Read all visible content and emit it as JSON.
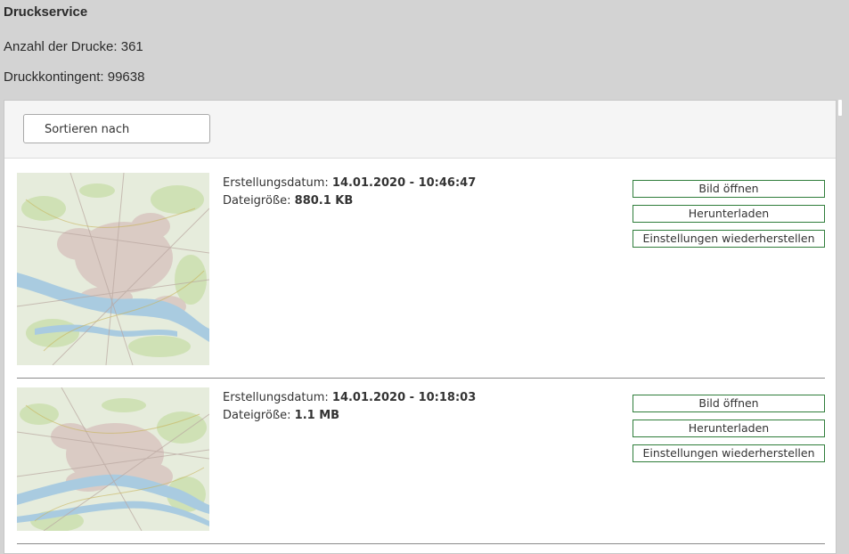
{
  "header": {
    "title": "Druckservice",
    "print_count_label": "Anzahl der Drucke: 361",
    "quota_label": "Druckkontingent: 99638"
  },
  "toolbar": {
    "sort_label": "Sortieren nach"
  },
  "prints": [
    {
      "created_label": "Erstellungsdatum:",
      "created_value": "14.01.2020 - 10:46:47",
      "size_label": "Dateigröße:",
      "size_value": "880.1 KB",
      "open_label": "Bild öffnen",
      "download_label": "Herunterladen",
      "restore_label": "Einstellungen wiederherstellen"
    },
    {
      "created_label": "Erstellungsdatum:",
      "created_value": "14.01.2020 - 10:18:03",
      "size_label": "Dateigröße:",
      "size_value": "1.1 MB",
      "open_label": "Bild öffnen",
      "download_label": "Herunterladen",
      "restore_label": "Einstellungen wiederherstellen"
    }
  ],
  "colors": {
    "background": "#d3d3d3",
    "button_border": "#2f7d3a",
    "map_river": "#a9cbe0",
    "map_urban": "#d8c6c0",
    "map_green": "#cfe1b5"
  }
}
